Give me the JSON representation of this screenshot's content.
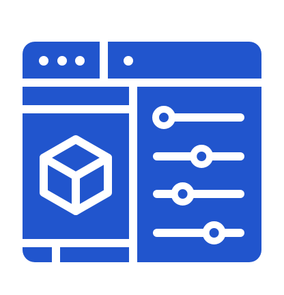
{
  "icon": {
    "name": "3d-config-window-icon",
    "colors": {
      "fill": "#2155cd",
      "line": "#ffffff",
      "background": "#ffffff"
    },
    "window": {
      "title_bar_dots": 3,
      "tab_dots": 1
    },
    "preview_panel": {
      "symbol": "cube-icon"
    },
    "settings_panel": {
      "sliders": [
        {
          "level": 0.0
        },
        {
          "level": 0.6
        },
        {
          "level": 0.3
        },
        {
          "level": 0.8
        }
      ]
    }
  }
}
